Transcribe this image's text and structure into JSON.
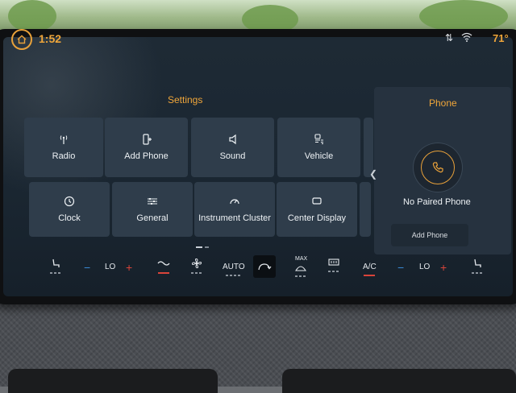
{
  "status_bar": {
    "time": "1:52",
    "temperature": "71°",
    "icons": [
      "home-icon",
      "swap-arrows-icon",
      "wifi-icon"
    ]
  },
  "settings": {
    "title": "Settings",
    "tiles": [
      {
        "label": "Radio",
        "icon": "antenna-icon"
      },
      {
        "label": "Add Phone",
        "icon": "phone-plus-icon"
      },
      {
        "label": "Sound",
        "icon": "speaker-icon"
      },
      {
        "label": "Vehicle",
        "icon": "vehicle-settings-icon"
      },
      {
        "label": "Clock",
        "icon": "clock-icon"
      },
      {
        "label": "General",
        "icon": "sliders-icon"
      },
      {
        "label": "Instrument Cluster",
        "icon": "gauge-icon"
      },
      {
        "label": "Center Display",
        "icon": "display-icon"
      }
    ]
  },
  "phone": {
    "title": "Phone",
    "status": "No Paired Phone",
    "add_button": "Add Phone"
  },
  "climate": {
    "driver_temp": "LO",
    "passenger_temp": "LO",
    "auto_label": "AUTO",
    "max_label": "MAX",
    "ac_label": "A/C",
    "minus": "−",
    "plus": "+"
  },
  "colors": {
    "accent": "#f0a63a",
    "tile_bg": "#2f3d4b",
    "screen_bg": "#1e2a35",
    "minus": "#3a8bd8",
    "plus": "#d9443a"
  }
}
